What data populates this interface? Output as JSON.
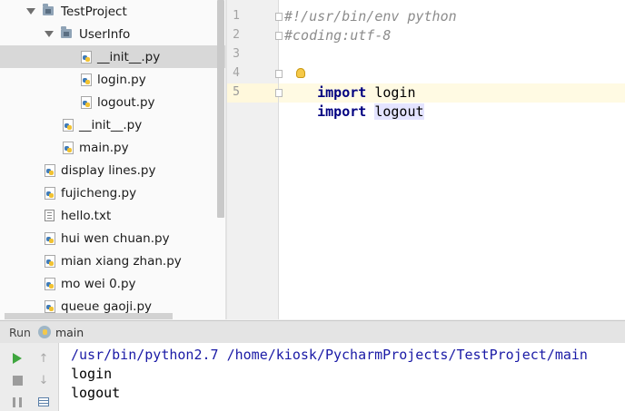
{
  "project_tree": {
    "items": [
      {
        "label": "TestProject",
        "type": "folder",
        "expanded": true
      },
      {
        "label": "UserInfo",
        "type": "folder",
        "expanded": true
      },
      {
        "label": "__init__.py",
        "type": "python",
        "selected": true
      },
      {
        "label": "login.py",
        "type": "python"
      },
      {
        "label": "logout.py",
        "type": "python"
      },
      {
        "label": "__init__.py",
        "type": "python"
      },
      {
        "label": "main.py",
        "type": "python"
      },
      {
        "label": "display lines.py",
        "type": "python"
      },
      {
        "label": "fujicheng.py",
        "type": "python"
      },
      {
        "label": "hello.txt",
        "type": "text"
      },
      {
        "label": "hui wen chuan.py",
        "type": "python"
      },
      {
        "label": "mian xiang zhan.py",
        "type": "python"
      },
      {
        "label": "mo wei 0.py",
        "type": "python"
      },
      {
        "label": "queue gaoji.py",
        "type": "python"
      }
    ]
  },
  "editor": {
    "line_numbers": [
      "1",
      "2",
      "3",
      "4",
      "5"
    ],
    "lines": {
      "l1": "#!/usr/bin/env python",
      "l2": "#coding:utf-8",
      "l4_kw": "import",
      "l4_rest": " login",
      "l5_kw": "import",
      "l5_rest": "logout"
    },
    "current_line": 5
  },
  "run_panel": {
    "title": "Run",
    "tab_label": "main",
    "console": [
      "/usr/bin/python2.7 /home/kiosk/PycharmProjects/TestProject/main",
      "login",
      "logout"
    ]
  },
  "colors": {
    "keyword": "#000080",
    "comment": "#8c8c8c",
    "run_green": "#3fa63f",
    "console_cmd": "#1a1aa6"
  }
}
